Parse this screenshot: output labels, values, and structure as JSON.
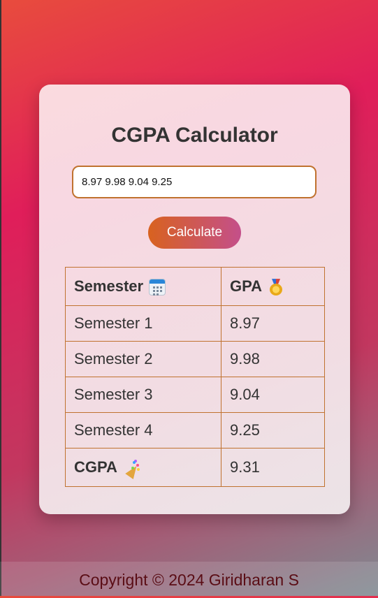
{
  "calculator": {
    "title": "CGPA Calculator",
    "input_value": "8.97 9.98 9.04 9.25",
    "calculate_label": "Calculate"
  },
  "results": {
    "header_semester": "Semester",
    "header_gpa": "GPA",
    "header_semester_icon": "calendar-icon",
    "header_gpa_icon": "medal-icon",
    "rows": [
      {
        "semester": "Semester 1",
        "gpa": "8.97"
      },
      {
        "semester": "Semester 2",
        "gpa": "9.98"
      },
      {
        "semester": "Semester 3",
        "gpa": "9.04"
      },
      {
        "semester": "Semester 4",
        "gpa": "9.25"
      }
    ],
    "total_label": "CGPA",
    "total_icon": "party-popper-icon",
    "total_value": "9.31"
  },
  "footer": {
    "copyright": "Copyright © 2024 Giridharan S"
  },
  "colors": {
    "accent_border": "#c0722f",
    "button_gradient_start": "#d8621f",
    "button_gradient_end": "#c44f8a"
  }
}
